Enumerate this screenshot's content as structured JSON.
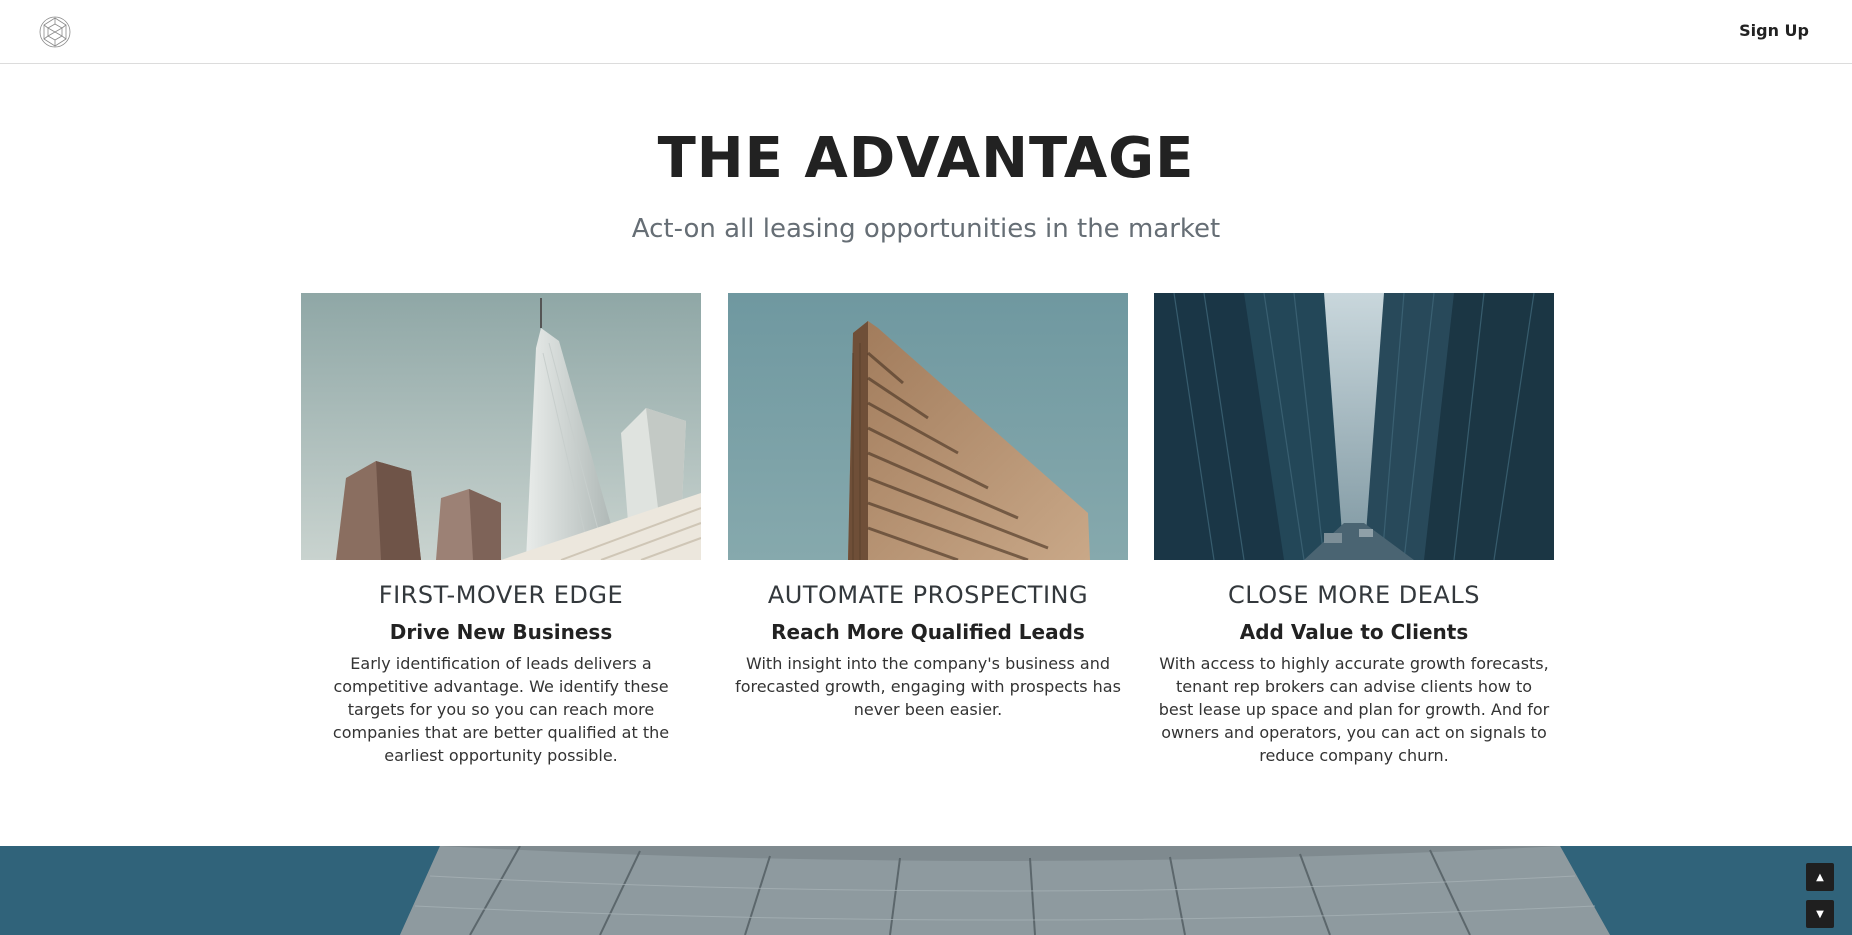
{
  "header": {
    "logo_icon": "geodesic-sphere-icon",
    "signup_label": "Sign Up"
  },
  "section": {
    "title": "THE ADVANTAGE",
    "subtitle": "Act-on all leasing opportunities in the market"
  },
  "cards": [
    {
      "image": "skyscrapers-photo",
      "heading": "FIRST-MOVER EDGE",
      "subheading": "Drive New Business",
      "text": "Early identification of leads delivers a competitive advantage. We identify these targets for you so you can reach more companies that are better qualified at the earliest opportunity possible."
    },
    {
      "image": "flatiron-building-photo",
      "heading": "AUTOMATE PROSPECTING",
      "subheading": "Reach More Qualified Leads",
      "text": "With insight into the company's business and forecasted growth, engaging with prospects has never been easier."
    },
    {
      "image": "city-street-photo",
      "heading": "CLOSE MORE DEALS",
      "subheading": "Add Value to Clients",
      "text": "With access to highly accurate growth forecasts, tenant rep brokers can advise clients how to best lease up space and plan for growth. And for owners and operators, you can act on signals to reduce company churn."
    }
  ],
  "scroll_controls": {
    "up_icon": "triangle-up-icon",
    "down_icon": "triangle-down-icon",
    "up_glyph": "▲",
    "down_glyph": "▼"
  },
  "colors": {
    "banner": "#30637a",
    "title": "#222222",
    "subtitle": "#666e75"
  }
}
